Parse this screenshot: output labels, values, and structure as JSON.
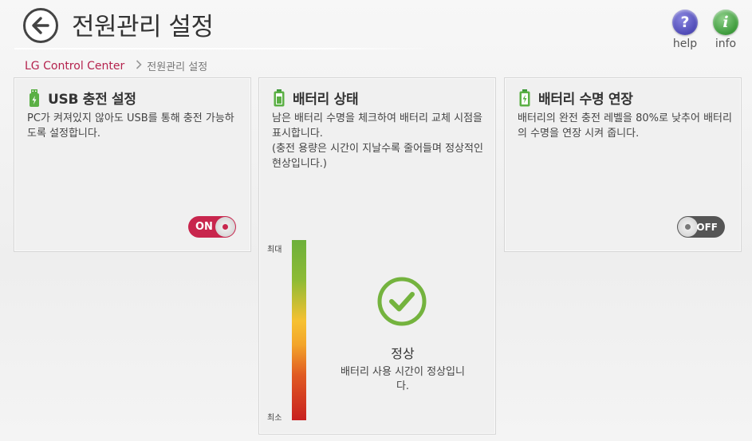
{
  "header": {
    "title": "전원관리 설정",
    "help_label": "help",
    "info_label": "info"
  },
  "breadcrumb": {
    "home": "LG Control Center",
    "current": "전원관리 설정"
  },
  "cards": {
    "usb": {
      "title": "USB 충전 설정",
      "description": "PC가 켜져있지 않아도 USB를 통해 충전 가능하도록 설정합니다.",
      "toggle_label": "ON",
      "toggle_state": "on"
    },
    "battery": {
      "title": "배터리 상태",
      "description_1": "남은 배터리 수명을 체크하여 배터리 교체 시점을 표시합니다.",
      "description_2": "(충전 용량은 시간이 지날수록 줄어들며 정상적인 현상입니다.)",
      "gauge_max": "최대",
      "gauge_min": "최소",
      "status_title": "정상",
      "status_desc": "배터리 사용 시간이 정상입니다."
    },
    "life": {
      "title": "배터리 수명 연장",
      "description": "배터리의 완전 충전 레벨을 80%로 낮추어 배터리의 수명을 연장 시켜 줍니다.",
      "toggle_label": "OFF",
      "toggle_state": "off"
    }
  },
  "colors": {
    "accent": "#c8264d",
    "ok_green": "#6db03b"
  }
}
